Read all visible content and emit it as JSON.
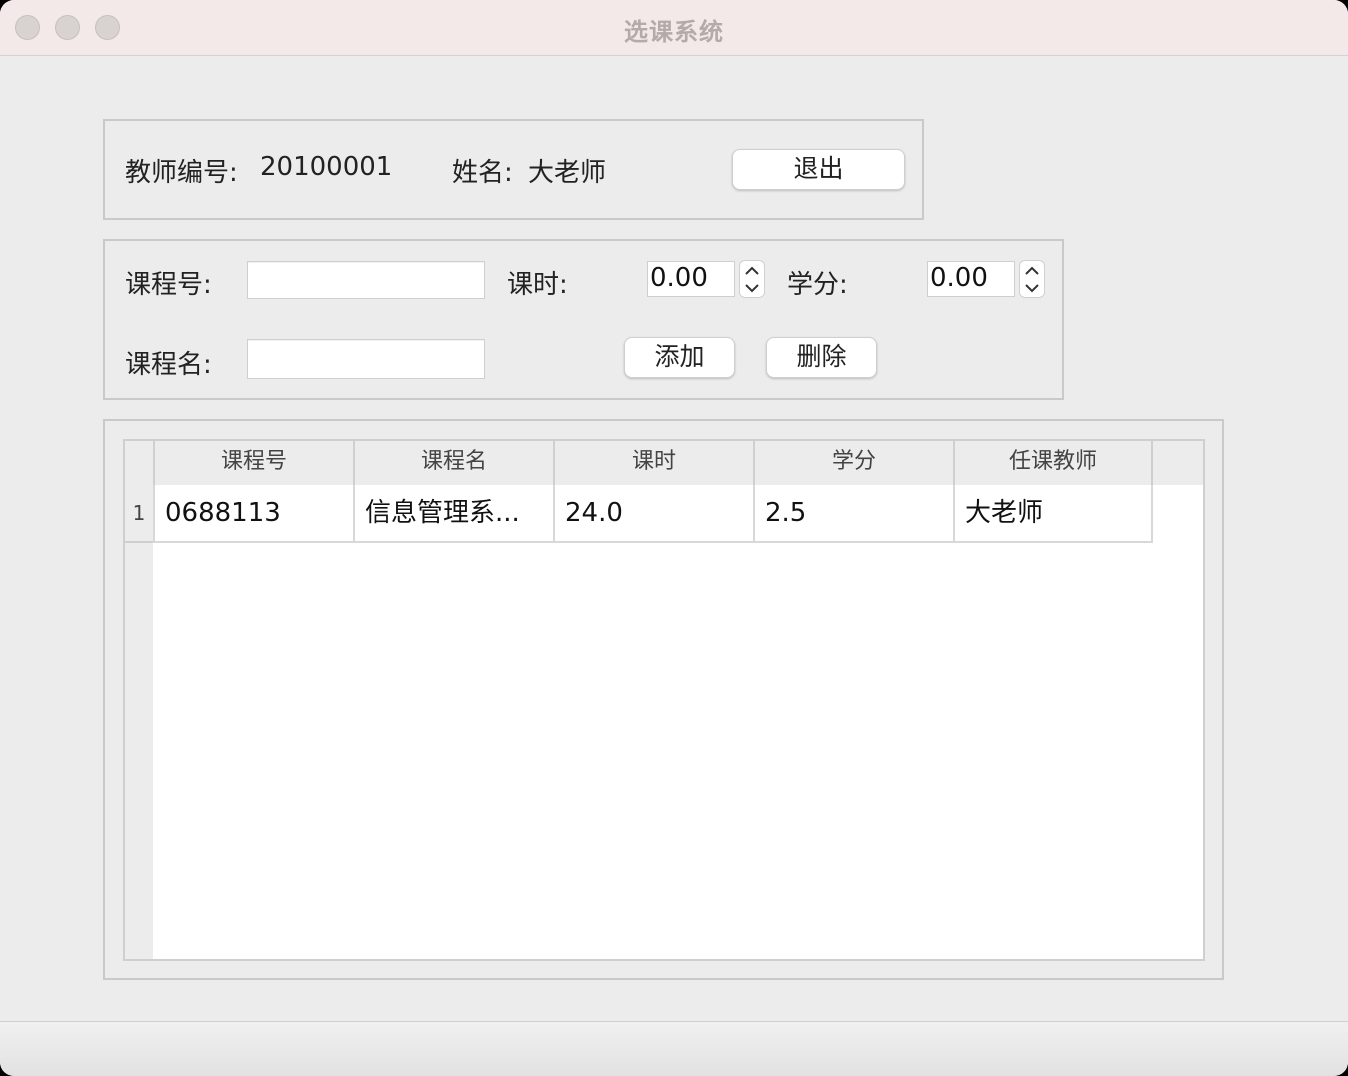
{
  "window": {
    "title": "选课系统"
  },
  "teacher_info": {
    "id_label": "教师编号:",
    "id_value": "20100001",
    "name_label": "姓名:",
    "name_value": "大老师",
    "exit_label": "退出"
  },
  "course_form": {
    "course_no_label": "课程号:",
    "course_no_value": "",
    "course_name_label": "课程名:",
    "course_name_value": "",
    "hours_label": "课时:",
    "hours_value": "0.00",
    "credit_label": "学分:",
    "credit_value": "0.00",
    "add_label": "添加",
    "delete_label": "删除"
  },
  "table": {
    "columns": [
      "课程号",
      "课程名",
      "课时",
      "学分",
      "任课教师"
    ],
    "rows": [
      {
        "num": "1",
        "cells": [
          "0688113",
          "信息管理系...",
          "24.0",
          "2.5",
          "大老师"
        ]
      }
    ]
  }
}
